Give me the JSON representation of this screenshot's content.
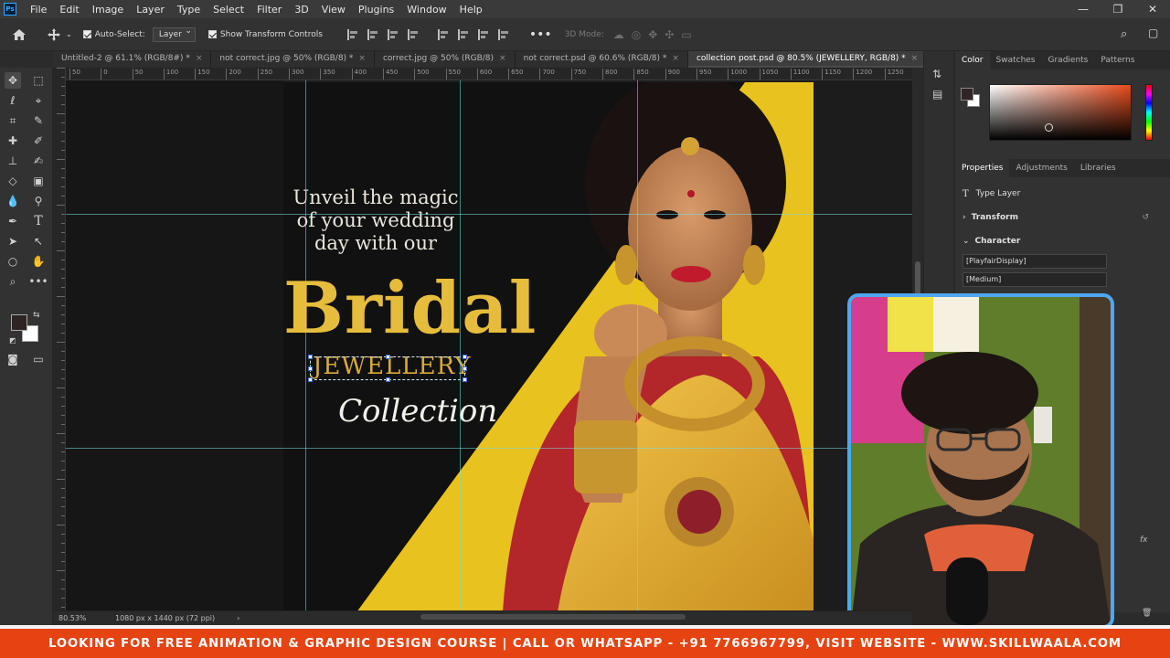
{
  "app": {
    "logo_text": "Ps",
    "menu": [
      "File",
      "Edit",
      "Image",
      "Layer",
      "Type",
      "Select",
      "Filter",
      "3D",
      "View",
      "Plugins",
      "Window",
      "Help"
    ],
    "window_controls": [
      "—",
      "❐",
      "✕"
    ]
  },
  "options_bar": {
    "auto_select_label": "Auto-Select:",
    "auto_select_value": "Layer",
    "show_transform_label": "Show Transform Controls",
    "mode_3d_label": "3D Mode:"
  },
  "tabs": [
    {
      "label": "Untitled-2 @ 61.1% (RGB/8#) *",
      "active": false
    },
    {
      "label": "not correct.jpg @ 50% (RGB/8) *",
      "active": false
    },
    {
      "label": "correct.jpg @ 50% (RGB/8)",
      "active": false
    },
    {
      "label": "not correct.psd @ 60.6% (RGB/8) *",
      "active": false
    },
    {
      "label": "collection post.psd @ 80.5% (JEWELLERY, RGB/8) *",
      "active": true
    }
  ],
  "tab_close_glyph": "×",
  "ruler": {
    "labels": [
      "50",
      "0",
      "50",
      "100",
      "150",
      "200",
      "250",
      "300",
      "350",
      "400",
      "450",
      "500",
      "550",
      "600",
      "650",
      "700",
      "750",
      "800",
      "850",
      "900",
      "950",
      "1000",
      "1050",
      "1100",
      "1150",
      "1200",
      "1250"
    ]
  },
  "design": {
    "headline_lines": [
      "Unveil the magic",
      "of your wedding",
      "day with our"
    ],
    "title": "Bridal",
    "subtitle": "JEWELLERY",
    "tagline": "Collection",
    "colors": {
      "gold": "#e6bc3c",
      "yellow": "#e8c21e",
      "dark": "#111111"
    }
  },
  "panels": {
    "color_tabs": [
      "Color",
      "Swatches",
      "Gradients",
      "Patterns"
    ],
    "props_tabs": [
      "Properties",
      "Adjustments",
      "Libraries"
    ],
    "layer_kind": "Type Layer",
    "transform_label": "Transform",
    "character_label": "Character",
    "font_family": "[PlayfairDisplay]",
    "font_style": "[Medium]",
    "fx_label": "fx"
  },
  "status": {
    "zoom": "80.53%",
    "doc_info": "1080 px x 1440 px (72 ppi)"
  },
  "banner": {
    "text": "LOOKING FOR FREE ANIMATION & GRAPHIC DESIGN COURSE | CALL OR WHATSAPP - +91 7766967799, VISIT WEBSITE - WWW.SKILLWAALA.COM",
    "color": "#e64312"
  }
}
